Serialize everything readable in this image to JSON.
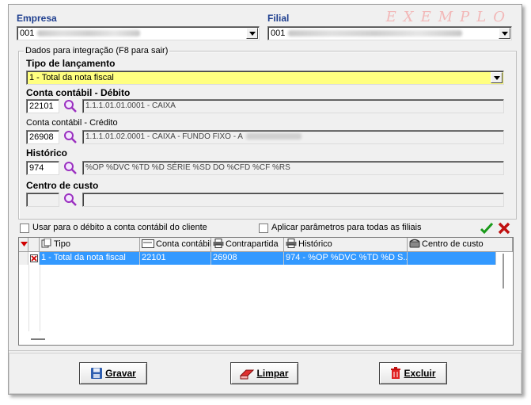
{
  "watermark": "EXEMPLO",
  "empresa": {
    "label": "Empresa",
    "value": "001"
  },
  "filial": {
    "label": "Filial",
    "value": "001"
  },
  "group_title": "Dados para integração  (F8 para sair)",
  "tipo": {
    "label": "Tipo de lançamento",
    "value": "1  - Total da nota fiscal"
  },
  "debito": {
    "label": "Conta contábil - Débito",
    "code": "22101",
    "desc": "1.1.1.01.01.0001 - CAIXA"
  },
  "credito": {
    "label": "Conta contábil - Crédito",
    "code": "26908",
    "desc": "1.1.1.01.02.0001 - CAIXA - FUNDO FIXO - A"
  },
  "historico": {
    "label": "Histórico",
    "code": "974",
    "desc": "%OP %DVC %TD %D SÉRIE %SD DO %CFD %CF %RS"
  },
  "centro": {
    "label": "Centro de custo",
    "code": "",
    "desc": ""
  },
  "options": {
    "usar_debito": "Usar para o débito a conta contábil do cliente",
    "aplicar_todas": "Aplicar parâmetros para todas as filiais"
  },
  "grid": {
    "headers": [
      "Tipo",
      "Conta contábil",
      "Contrapartida",
      "Histórico",
      "Centro de custo"
    ],
    "rows": [
      {
        "tipo": "1  - Total da nota fiscal",
        "conta": "22101",
        "contrapartida": "26908",
        "historico": "974 - %OP %DVC %TD %D S...",
        "centro": ""
      }
    ]
  },
  "buttons": {
    "gravar": "Gravar",
    "limpar": "Limpar",
    "excluir": "Excluir"
  },
  "colors": {
    "label_blue": "#1f3f8f",
    "highlight_yellow": "#ffff80",
    "selection": "#3399ff"
  }
}
